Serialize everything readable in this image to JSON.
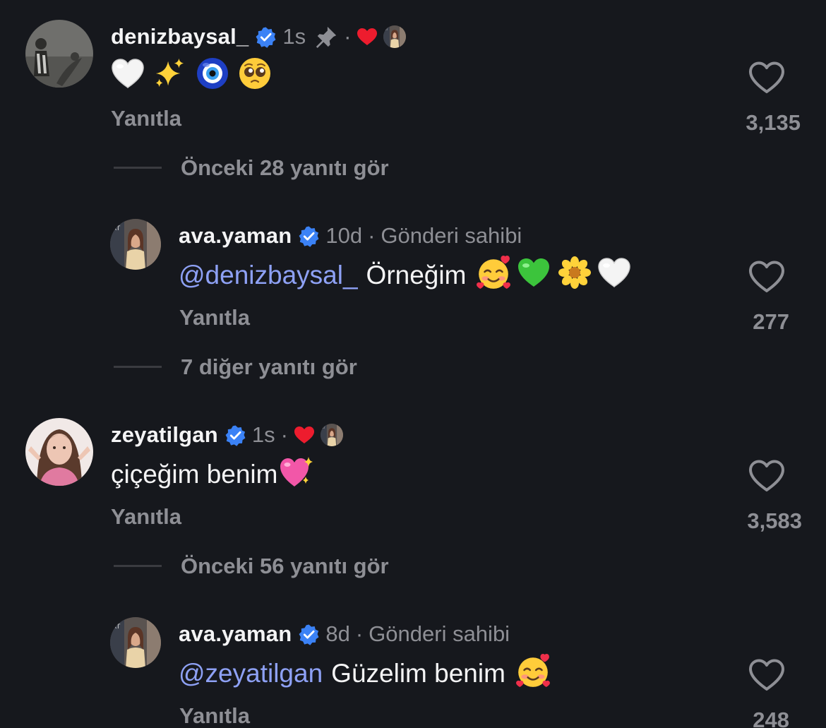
{
  "comments": [
    {
      "username": "denizbaysal_",
      "time": "1s",
      "pinned": true,
      "text": "",
      "emojis": [
        "white-heart",
        "sparkles",
        "nazar-amulet",
        "pleading-face"
      ],
      "reply_label": "Yanıtla",
      "likes": "3,135",
      "view_replies": "Önceki 28 yanıtı gör"
    },
    {
      "username": "ava.yaman",
      "time": "10d",
      "author_tag": "Gönderi sahibi",
      "mention": "@denizbaysal_",
      "text": "Örneğim",
      "emojis": [
        "smiling-face-with-hearts",
        "green-heart",
        "blossom",
        "white-heart"
      ],
      "reply_label": "Yanıtla",
      "likes": "277",
      "view_replies": "7 diğer yanıtı gör"
    },
    {
      "username": "zeyatilgan",
      "time": "1s",
      "text": "çiçeğim benim",
      "emojis": [
        "sparkling-heart"
      ],
      "reply_label": "Yanıtla",
      "likes": "3,583",
      "view_replies": "Önceki 56 yanıtı gör"
    },
    {
      "username": "ava.yaman",
      "time": "8d",
      "author_tag": "Gönderi sahibi",
      "mention": "@zeyatilgan",
      "text": "Güzelim benim",
      "emojis": [
        "smiling-face-with-hearts"
      ],
      "reply_label": "Yanıtla",
      "likes": "248"
    }
  ],
  "separator": "·",
  "colors": {
    "background": "#16181d",
    "text": "#f4f4f5",
    "muted": "#8e8f95",
    "mention": "#8ea1f5",
    "verified": "#3b82f6",
    "liked_heart": "#ed1c2e"
  }
}
